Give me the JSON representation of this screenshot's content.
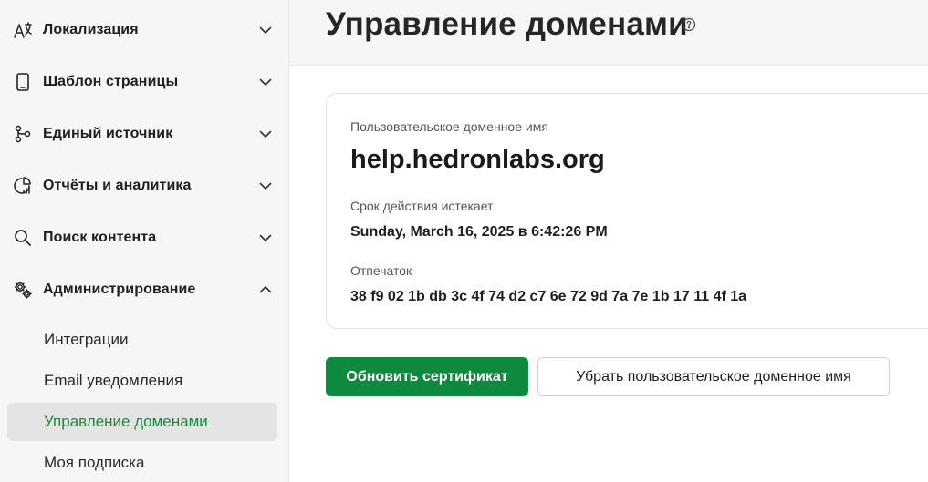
{
  "sidebar": {
    "items": [
      {
        "label": "Локализация",
        "icon": "translate-icon",
        "expanded": false
      },
      {
        "label": "Шаблон страницы",
        "icon": "mobile-device-icon",
        "expanded": false
      },
      {
        "label": "Единый источник",
        "icon": "branch-icon",
        "expanded": false
      },
      {
        "label": "Отчёты и аналитика",
        "icon": "analytics-pie-icon",
        "expanded": false
      },
      {
        "label": "Поиск контента",
        "icon": "search-icon",
        "expanded": false
      },
      {
        "label": "Администрирование",
        "icon": "gears-icon",
        "expanded": true
      }
    ],
    "subitems": [
      {
        "label": "Интеграции",
        "active": false
      },
      {
        "label": "Email уведомления",
        "active": false
      },
      {
        "label": "Управление доменами",
        "active": true
      },
      {
        "label": "Моя подписка",
        "active": false
      }
    ]
  },
  "header": {
    "title": "Управление доменами",
    "help_icon": "help-circle-icon"
  },
  "card": {
    "domain_label": "Пользовательское доменное имя",
    "domain_value": "help.hedronlabs.org",
    "expiry_label": "Срок действия истекает",
    "expiry_value": "Sunday, March 16, 2025 в 6:42:26 PM",
    "fingerprint_label": "Отпечаток",
    "fingerprint_value": "38 f9 02 1b db 3c 4f 74 d2 c7 6e 72 9d 7a 7e 1b 17 11 4f 1a"
  },
  "actions": {
    "renew_label": "Обновить сертификат",
    "remove_label": "Убрать пользовательское доменное имя"
  },
  "colors": {
    "accent": "#0e8a3e",
    "active_text": "#178a3e",
    "sidebar_bg": "#f6f6f6"
  }
}
